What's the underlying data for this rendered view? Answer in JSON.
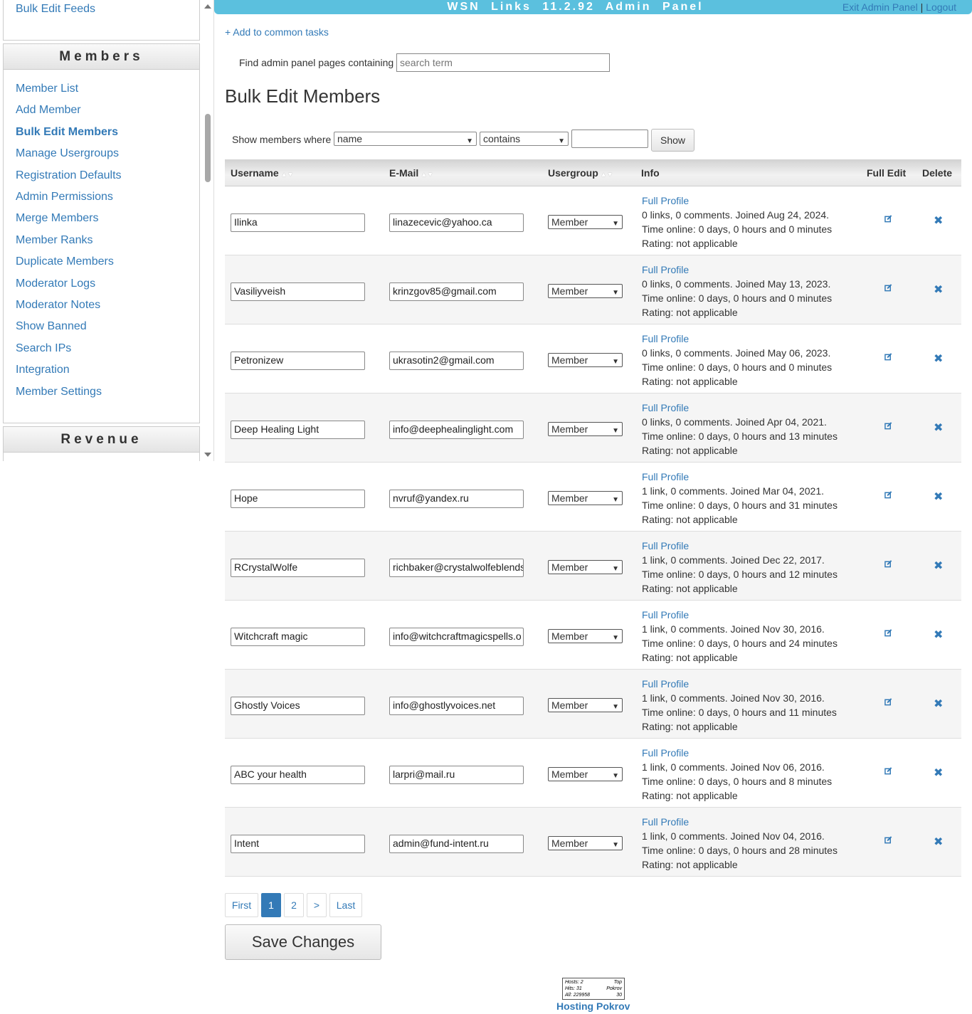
{
  "header": {
    "title": "WSN Links 11.2.92 Admin Panel",
    "exit_label": "Exit Admin Panel",
    "separator": "|",
    "logout_label": "Logout"
  },
  "sidebar": {
    "top_link": "Bulk Edit Feeds",
    "members_heading": "Members",
    "members_items": [
      {
        "label": "Member List"
      },
      {
        "label": "Add Member"
      },
      {
        "label": "Bulk Edit Members",
        "active": true
      },
      {
        "label": "Manage Usergroups"
      },
      {
        "label": "Registration Defaults"
      },
      {
        "label": "Admin Permissions"
      },
      {
        "label": "Merge Members"
      },
      {
        "label": "Member Ranks"
      },
      {
        "label": "Duplicate Members"
      },
      {
        "label": "Moderator Logs"
      },
      {
        "label": "Moderator Notes"
      },
      {
        "label": "Show Banned"
      },
      {
        "label": "Search IPs"
      },
      {
        "label": "Integration"
      },
      {
        "label": "Member Settings"
      }
    ],
    "revenue_heading": "Revenue"
  },
  "main": {
    "add_common": "+ Add to common tasks",
    "find_label": "Find admin panel pages containing",
    "find_placeholder": "search term",
    "page_title": "Bulk Edit Members",
    "filter": {
      "label": "Show members where",
      "field": "name",
      "operator": "contains",
      "value": "",
      "show_button": "Show"
    }
  },
  "table": {
    "columns": {
      "username": "Username",
      "email": "E-Mail",
      "usergroup": "Usergroup",
      "info": "Info",
      "full_edit": "Full Edit",
      "delete": "Delete"
    },
    "full_profile_label": "Full Profile",
    "rows": [
      {
        "username": "Ilinka",
        "email": "linazecevic@yahoo.ca",
        "usergroup": "Member",
        "summary": "0 links, 0 comments. Joined Aug 24, 2024.",
        "online": "Time online: 0 days, 0 hours and 0 minutes",
        "rating": "Rating: not applicable"
      },
      {
        "username": "Vasiliyveish",
        "email": "krinzgov85@gmail.com",
        "usergroup": "Member",
        "summary": "0 links, 0 comments. Joined May 13, 2023.",
        "online": "Time online: 0 days, 0 hours and 0 minutes",
        "rating": "Rating: not applicable"
      },
      {
        "username": "Petronizew",
        "email": "ukrasotin2@gmail.com",
        "usergroup": "Member",
        "summary": "0 links, 0 comments. Joined May 06, 2023.",
        "online": "Time online: 0 days, 0 hours and 0 minutes",
        "rating": "Rating: not applicable"
      },
      {
        "username": "Deep Healing Light",
        "email": "info@deephealinglight.com",
        "usergroup": "Member",
        "summary": "0 links, 0 comments. Joined Apr 04, 2021.",
        "online": "Time online: 0 days, 0 hours and 13 minutes",
        "rating": "Rating: not applicable"
      },
      {
        "username": "Hope",
        "email": "nvruf@yandex.ru",
        "usergroup": "Member",
        "summary": "1 link, 0 comments. Joined Mar 04, 2021.",
        "online": "Time online: 0 days, 0 hours and 31 minutes",
        "rating": "Rating: not applicable"
      },
      {
        "username": "RCrystalWolfe",
        "email": "richbaker@crystalwolfeblends",
        "usergroup": "Member",
        "summary": "1 link, 0 comments. Joined Dec 22, 2017.",
        "online": "Time online: 0 days, 0 hours and 12 minutes",
        "rating": "Rating: not applicable"
      },
      {
        "username": "Witchcraft magic",
        "email": "info@witchcraftmagicspells.o",
        "usergroup": "Member",
        "summary": "1 link, 0 comments. Joined Nov 30, 2016.",
        "online": "Time online: 0 days, 0 hours and 24 minutes",
        "rating": "Rating: not applicable"
      },
      {
        "username": "Ghostly Voices",
        "email": "info@ghostlyvoices.net",
        "usergroup": "Member",
        "summary": "1 link, 0 comments. Joined Nov 30, 2016.",
        "online": "Time online: 0 days, 0 hours and 11 minutes",
        "rating": "Rating: not applicable"
      },
      {
        "username": "ABC your health",
        "email": "larpri@mail.ru",
        "usergroup": "Member",
        "summary": "1 link, 0 comments. Joined Nov 06, 2016.",
        "online": "Time online: 0 days, 0 hours and 8 minutes",
        "rating": "Rating: not applicable"
      },
      {
        "username": "Intent",
        "email": "admin@fund-intent.ru",
        "usergroup": "Member",
        "summary": "1 link, 0 comments. Joined Nov 04, 2016.",
        "online": "Time online: 0 days, 0 hours and 28 minutes",
        "rating": "Rating: not applicable"
      }
    ]
  },
  "pagination": {
    "first": "First",
    "pages": [
      "1",
      "2"
    ],
    "current": "1",
    "next": ">",
    "last": "Last"
  },
  "save_button": "Save Changes",
  "footer": {
    "counter": {
      "hosts_label": "Hosts:",
      "hosts_value": "2",
      "hits_label": "Hits:",
      "hits_value": "31",
      "all_label": "All:",
      "all_value": "229958",
      "top_label": "Top",
      "brand_label": "Pokrov",
      "rank": "30"
    },
    "hosting_link": "Hosting Pokrov"
  },
  "colors": {
    "accent": "#337ab7",
    "header_bar": "#5bc0de",
    "row_alt": "#f5f5f5"
  }
}
